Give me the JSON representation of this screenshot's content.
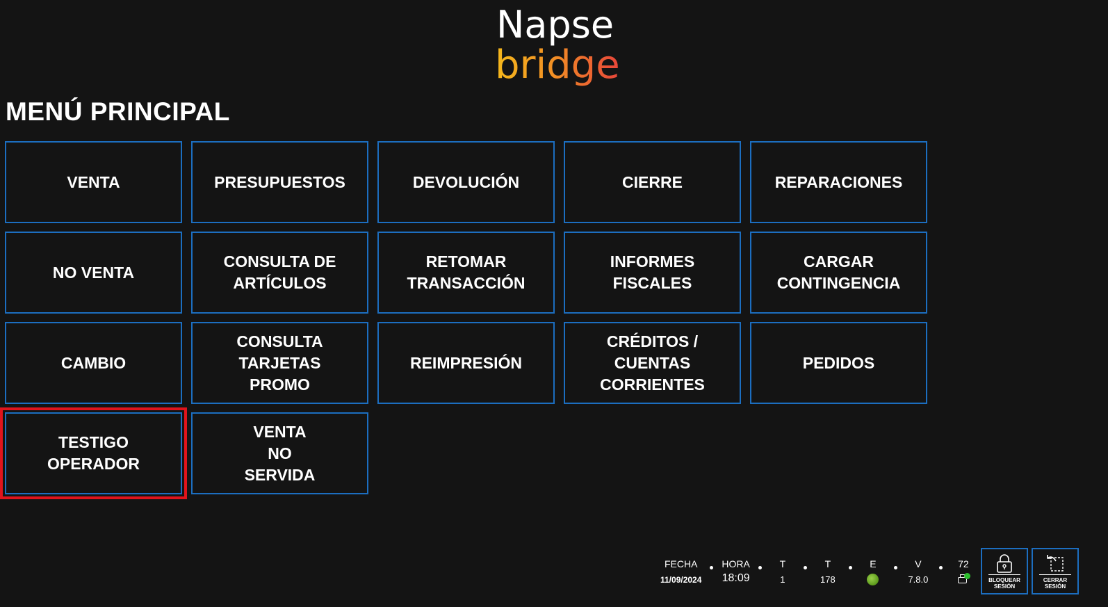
{
  "app": {
    "logo_line1": "Napse",
    "logo_line2": "bridge"
  },
  "page_title": "MENÚ PRINCIPAL",
  "menu": {
    "items": [
      {
        "label": "VENTA"
      },
      {
        "label": "PRESUPUESTOS"
      },
      {
        "label": "DEVOLUCIÓN"
      },
      {
        "label": "CIERRE"
      },
      {
        "label": "REPARACIONES"
      },
      {
        "label": "NO VENTA"
      },
      {
        "label": "CONSULTA DE\nARTÍCULOS"
      },
      {
        "label": "RETOMAR\nTRANSACCIÓN"
      },
      {
        "label": "INFORMES\nFISCALES"
      },
      {
        "label": "CARGAR\nCONTINGENCIA"
      },
      {
        "label": "CAMBIO"
      },
      {
        "label": "CONSULTA\nTARJETAS\nPROMO"
      },
      {
        "label": "REIMPRESIÓN"
      },
      {
        "label": "CRÉDITOS /\nCUENTAS\nCORRIENTES"
      },
      {
        "label": "PEDIDOS"
      },
      {
        "label": "TESTIGO\nOPERADOR",
        "selected": true
      },
      {
        "label": "VENTA\nNO\nSERVIDA"
      }
    ]
  },
  "status": {
    "fecha_label": "FECHA",
    "fecha_value": "11/09/2024",
    "hora_label": "HORA",
    "hora_value": "18:09",
    "t1_label": "T",
    "t1_value": "1",
    "t2_label": "T",
    "t2_value": "178",
    "e_label": "E",
    "e_status_color": "#6fae2a",
    "v_label": "V",
    "v_value": "7.8.0",
    "printer_count": "72",
    "printer_icon": "printer-icon",
    "printer_badge_color": "#2fbf2f"
  },
  "actions": {
    "lock_label": "BLOQUEAR\nSESIÓN",
    "lock_icon": "lock-icon",
    "logout_label": "CERRAR\nSESIÓN",
    "logout_icon": "logout-icon"
  },
  "colors": {
    "background": "#141414",
    "tile_border": "#1c6ec0",
    "selection": "#e0141c",
    "logo_gradient_start": "#f5b81c",
    "logo_gradient_end": "#e8453a"
  }
}
